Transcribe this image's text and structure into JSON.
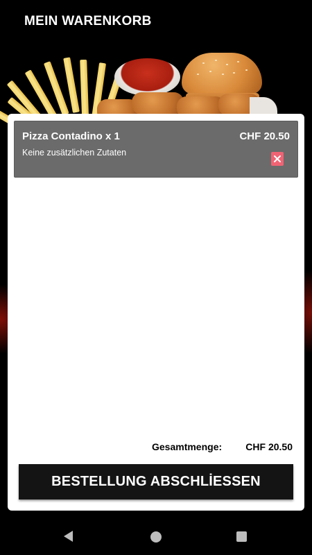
{
  "header": {
    "title": "MEIN WARENKORB"
  },
  "cart": {
    "items": [
      {
        "name": "Pizza Contadino x 1",
        "price": "CHF 20.50",
        "description": "Keine zusätzlichen Zutaten",
        "delete_icon": "close-icon"
      }
    ]
  },
  "summary": {
    "total_label": "Gesamtmenge:",
    "total_value": "CHF 20.50"
  },
  "checkout": {
    "label": "BESTELLUNG ABSCHLİESSEN"
  },
  "colors": {
    "card_bg": "#ffffff",
    "item_bg": "#6b6b6b",
    "delete_accent": "#f06374",
    "button_bg": "#141414",
    "page_bg": "#000000"
  },
  "navbar": {
    "icons": [
      "back-icon",
      "home-icon",
      "recents-icon"
    ]
  }
}
